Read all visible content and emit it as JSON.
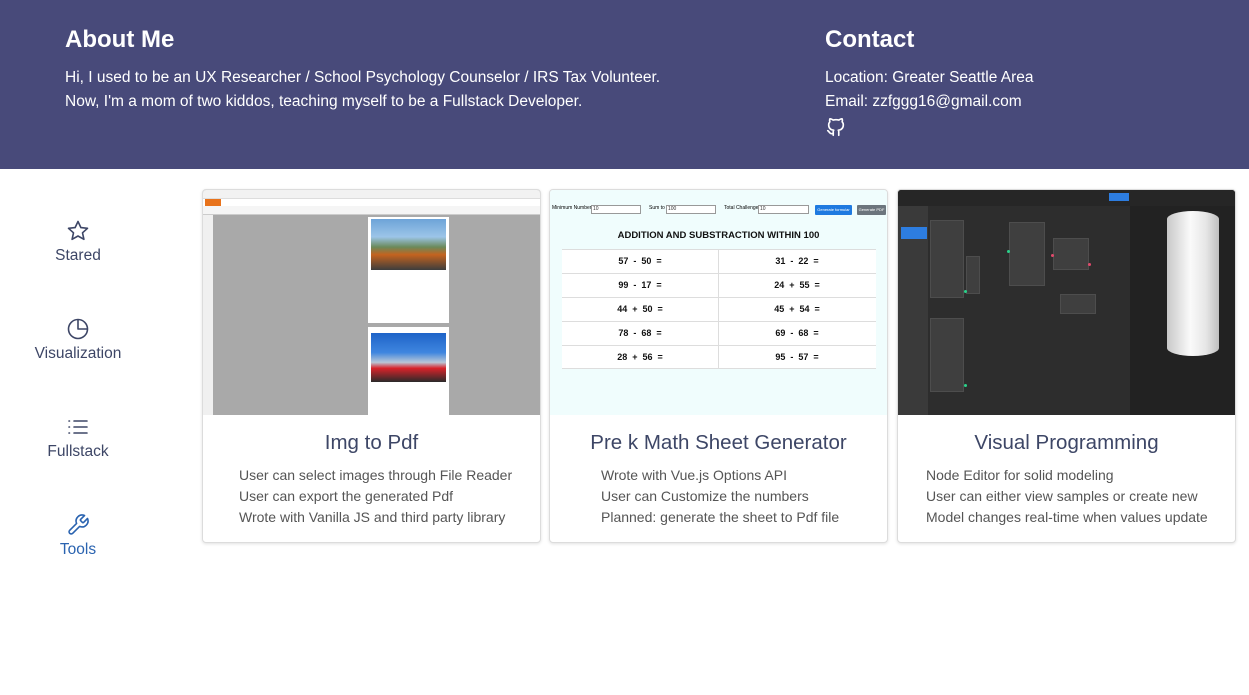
{
  "about": {
    "heading": "About Me",
    "line1": "Hi, I used to be an UX Researcher / School Psychology Counselor / IRS Tax Volunteer.",
    "line2": "Now, I'm a mom of two kiddos, teaching myself to be a Fullstack Developer."
  },
  "contact": {
    "heading": "Contact",
    "location": "Location: Greater Seattle Area",
    "email": "Email: zzfggg16@gmail.com",
    "github_icon": "github-icon"
  },
  "sidebar": {
    "items": [
      {
        "label": "Stared",
        "icon": "star-icon"
      },
      {
        "label": "Visualization",
        "icon": "pie-chart-icon"
      },
      {
        "label": "Fullstack",
        "icon": "list-icon"
      },
      {
        "label": "Tools",
        "icon": "wrench-icon",
        "active": true
      }
    ]
  },
  "cards": [
    {
      "title": "Img to Pdf",
      "bullets": [
        "User can select images through File Reader",
        "User can export the generated Pdf",
        "Wrote with Vanilla JS and third party library"
      ]
    },
    {
      "title": "Pre k Math Sheet Generator",
      "bullets": [
        "Wrote with Vue.js Options API",
        "User can Customize the numbers",
        "Planned: generate the sheet to Pdf file"
      ],
      "preview": {
        "min_label": "Minimum Number",
        "min_value": "10",
        "sum_label": "Sum to",
        "sum_value": "100",
        "total_label": "Total Challenges",
        "total_value": "10",
        "btn_generate": "Generate formular",
        "btn_pdf": "Generate PDF",
        "heading": "ADDITION AND SUBSTRACTION WITHIN 100",
        "problems_left": [
          "57  -  50  =",
          "99  -  17  =",
          "44  +  50  =",
          "78  -  68  =",
          "28  +  56  ="
        ],
        "problems_right": [
          "31  -  22  =",
          "24  +  55  =",
          "45  +  54  =",
          "69  -  68  =",
          "95  -  57  ="
        ]
      }
    },
    {
      "title": "Visual Programming",
      "bullets": [
        "Node Editor for solid modeling",
        "User can either view samples or create new",
        "Model changes real-time when values update"
      ]
    }
  ],
  "colors": {
    "hero_bg": "#484a7a",
    "nav_text": "#3d4666",
    "nav_active": "#2a63b0"
  }
}
